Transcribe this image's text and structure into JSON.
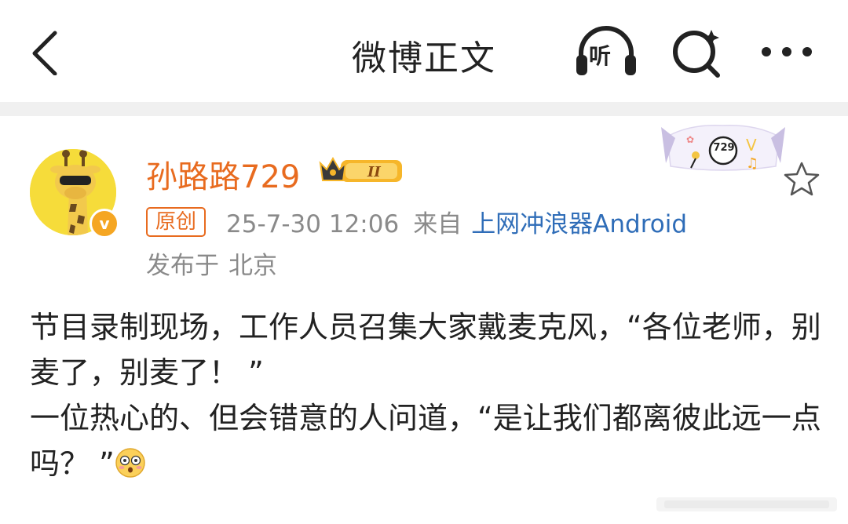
{
  "header": {
    "title": "微博正文",
    "listen_label": "听"
  },
  "post": {
    "username": "孙路路729",
    "original_tag": "原创",
    "timestamp": "25-7-30 12:06",
    "from_label": "来自",
    "source": "上网冲浪器Android",
    "published_at_label": "发布于",
    "location": "北京",
    "fan_badge_number": "729",
    "paragraphs": [
      "节目录制现场，工作人员召集大家戴麦克风，“各位老师，别麦了，别麦了！ ”",
      "一位热心的、但会错意的人问道，“是让我们都离彼此远一点吗？ ”"
    ],
    "emoji": "flushed-face-icon"
  },
  "colors": {
    "username": "#e86b1f",
    "link": "#2f6db8",
    "meta": "#8a8a8a",
    "divider": "#f0f0f0"
  }
}
